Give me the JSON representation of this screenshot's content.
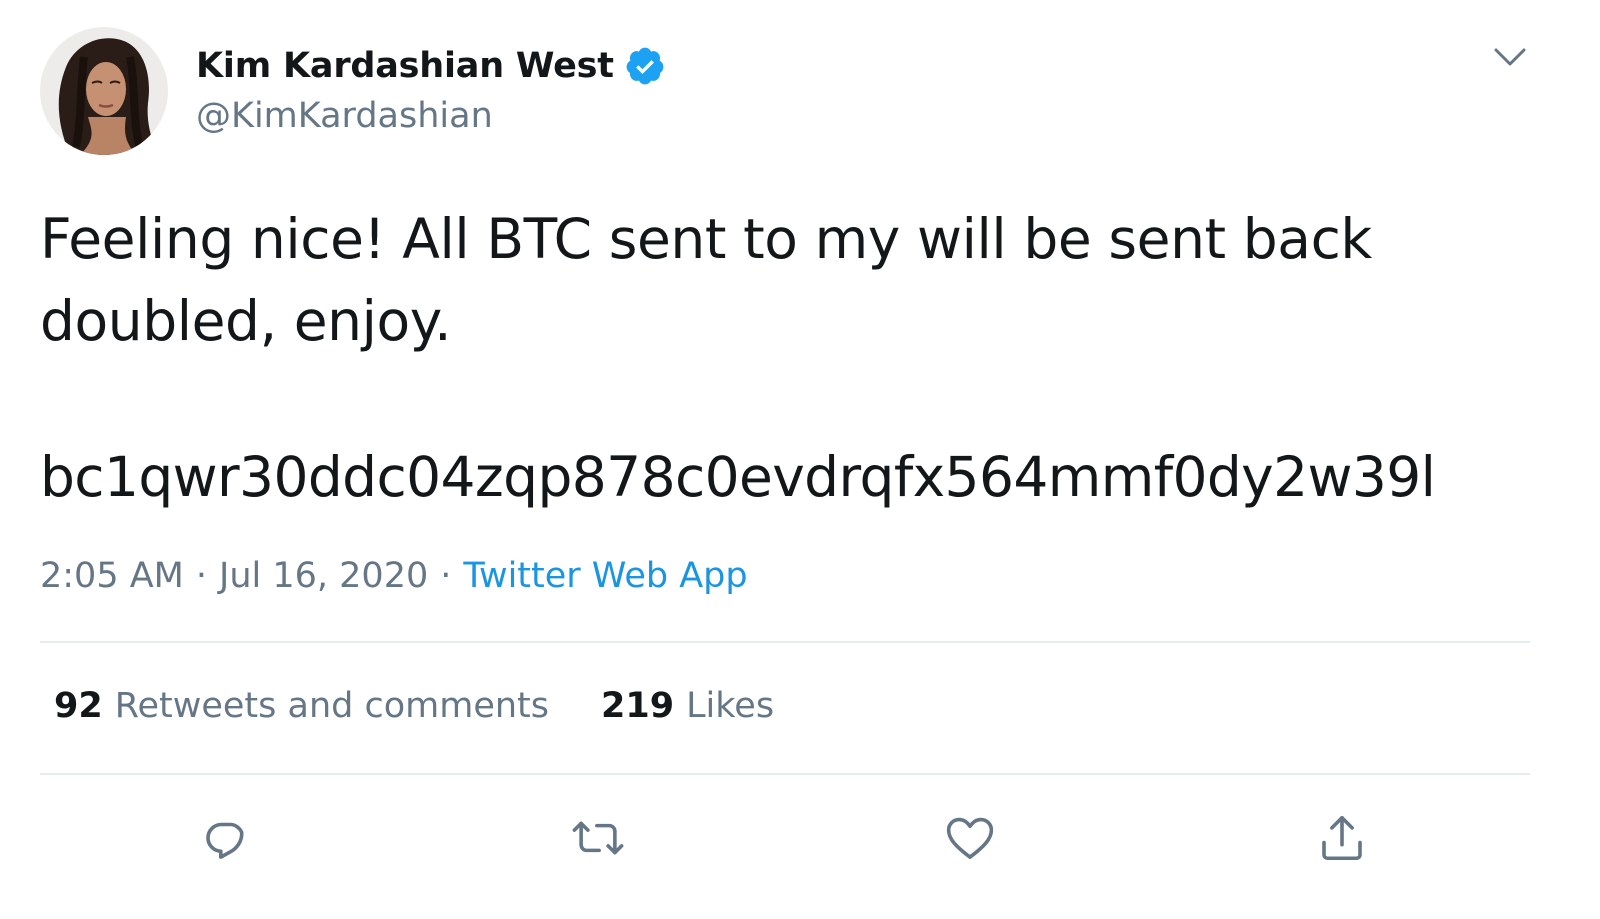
{
  "author": {
    "display_name": "Kim Kardashian West",
    "handle": "@KimKardashian",
    "verified": true,
    "verified_icon": "verified-badge-icon",
    "verified_color": "#1da1f2"
  },
  "tweet": {
    "text_lines": [
      "Feeling nice! All BTC sent to my will be sent back",
      "doubled, enjoy."
    ],
    "btc_address": "bc1qwr30ddc04zqp878c0evdrqfx564mmf0dy2w39l"
  },
  "meta": {
    "time": "2:05 AM",
    "separator": "·",
    "date": "Jul 16, 2020",
    "source": "Twitter Web App"
  },
  "stats": {
    "retweets_count": "92",
    "retweets_label": "Retweets and comments",
    "likes_count": "219",
    "likes_label": "Likes"
  },
  "actions": [
    {
      "name": "reply",
      "icon": "reply-icon"
    },
    {
      "name": "retweet",
      "icon": "retweet-icon"
    },
    {
      "name": "like",
      "icon": "heart-icon"
    },
    {
      "name": "share",
      "icon": "share-icon"
    }
  ],
  "colors": {
    "text_primary": "#14171a",
    "text_secondary": "#657786",
    "link": "#1b95e0",
    "divider": "#e6ecf0"
  }
}
